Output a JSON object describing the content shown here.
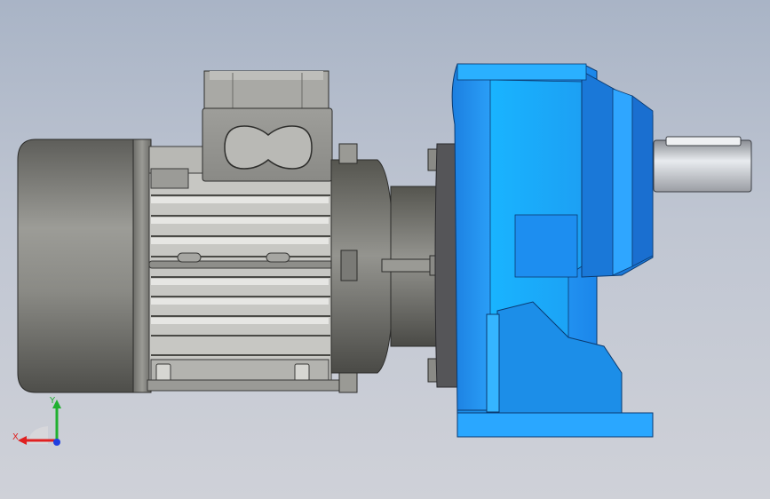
{
  "colors": {
    "background_top": "#a9b4c6",
    "background_bottom": "#cfd1d8",
    "motor_body": "#8a8a86",
    "gear_housing": "#1f8fe8",
    "gear_highlight": "#3ab6ff",
    "shaft": "#c9ccd2",
    "axis_x": "#e02020",
    "axis_y": "#20b030",
    "axis_z": "#2040e0"
  },
  "triad": {
    "x_label": "X",
    "y_label": "Y"
  }
}
